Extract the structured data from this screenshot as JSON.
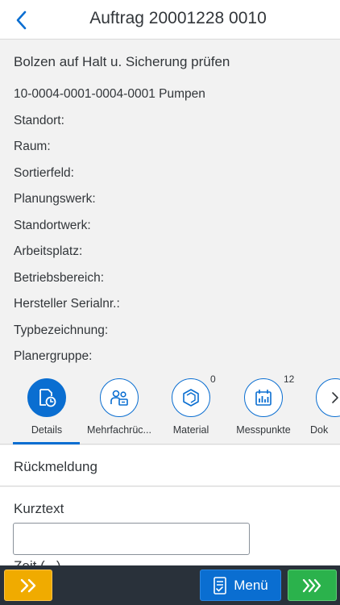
{
  "header": {
    "title": "Auftrag 20001228 0010"
  },
  "order": {
    "description": "Bolzen auf Halt u. Sicherung prüfen",
    "equipment": "10-0004-0001-0004-0001 Pumpen",
    "fields": [
      {
        "label": "Standort:",
        "value": ""
      },
      {
        "label": "Raum:",
        "value": ""
      },
      {
        "label": "Sortierfeld:",
        "value": ""
      },
      {
        "label": "Planungswerk:",
        "value": ""
      },
      {
        "label": "Standortwerk:",
        "value": ""
      },
      {
        "label": "Arbeitsplatz:",
        "value": ""
      },
      {
        "label": "Betriebsbereich:",
        "value": ""
      },
      {
        "label": "Hersteller Serialnr.:",
        "value": ""
      },
      {
        "label": "Typbezeichnung:",
        "value": ""
      },
      {
        "label": "Planergruppe:",
        "value": ""
      }
    ]
  },
  "tabs": [
    {
      "label": "Details",
      "icon": "document-clock-icon",
      "badge": "",
      "active": true
    },
    {
      "label": "Mehrfachrüc...",
      "icon": "persons-icon",
      "badge": "",
      "active": false
    },
    {
      "label": "Material",
      "icon": "cube-icon",
      "badge": "0",
      "active": false
    },
    {
      "label": "Messpunkte",
      "icon": "measurement-calendar-icon",
      "badge": "12",
      "active": false
    },
    {
      "label": "Dok",
      "icon": "chevron-right-icon",
      "badge": "",
      "active": false
    }
  ],
  "section": {
    "title": "Rückmeldung"
  },
  "form": {
    "kurztext_label": "Kurztext",
    "kurztext_value": "",
    "zeit_label": "Zeit (...)"
  },
  "footer": {
    "menu_label": "Menü"
  },
  "colors": {
    "accent": "#0a6ed1",
    "orange": "#f0ab00",
    "green": "#2bb24c",
    "footer_bg": "#29313a"
  }
}
